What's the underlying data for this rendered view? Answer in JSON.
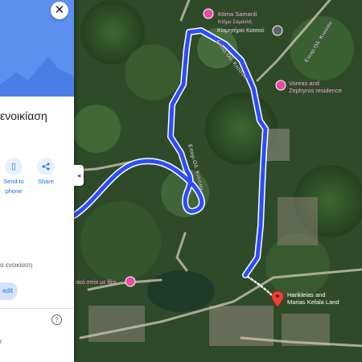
{
  "panel": {
    "close_glyph": "✕",
    "title": "ενοικίαση",
    "actions": [
      {
        "label_line1": "Send to",
        "label_line2": "phone",
        "icon": "phone-icon"
      },
      {
        "label_line1": "Share",
        "label_line2": "",
        "icon": "share-icon"
      }
    ],
    "subtitle": "α ενοικίαση",
    "chip_label": "edit",
    "help_glyph": "?",
    "bottom_fragment": "r"
  },
  "map": {
    "pois": [
      {
        "name": "Ktima Samanli",
        "sub": "Κτήμα Σαμανλή",
        "icon": "lodging-pin-icon"
      },
      {
        "name": "Κοιμητήριο Κισσού",
        "icon": "cemetery-pin-icon"
      },
      {
        "name_line1": "Voreas and",
        "name_line2": "Zephyros residence",
        "icon": "lodging-pin-icon"
      },
      {
        "name": "ακό σπίτι με θέα",
        "icon": "lodging-pin-icon"
      },
      {
        "name_line1": "Harikleias and",
        "name_line2": "Marias Kefala Land",
        "icon": "destination-pin-icon"
      }
    ],
    "roads": [
      {
        "name": "Επαρ.Οδ. Κισσού"
      },
      {
        "name": "Επαρ.Οδ. Κισσού"
      },
      {
        "name": "Επαρ.Οδ. Κισσού"
      }
    ],
    "colors": {
      "route": "#2b4cff",
      "route_outline": "#ffffff",
      "lodging_pin": "#e94ba4",
      "destination_pin": "#ea4335",
      "accent": "#1a73e8"
    }
  }
}
